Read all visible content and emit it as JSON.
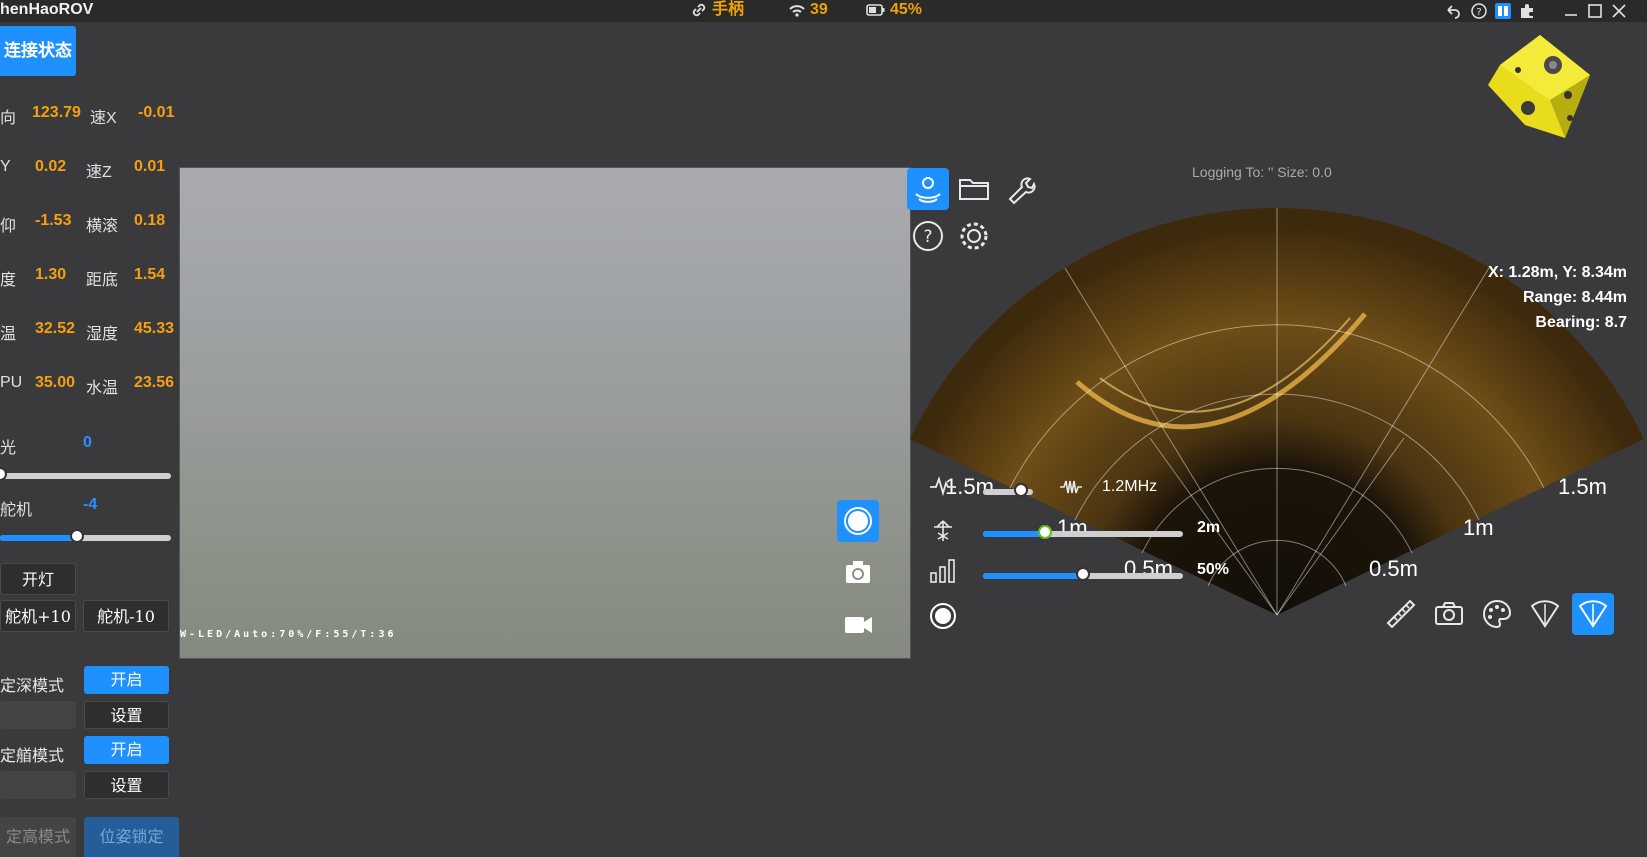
{
  "titlebar": {
    "app_title": "henHaoROV",
    "joystick_label": "手柄",
    "signal_value": "39",
    "battery_value": "45%"
  },
  "left_panel": {
    "connection_button": "连接状态",
    "telemetry": [
      {
        "label": "向",
        "value": "123.79"
      },
      {
        "label": "速X",
        "value": "-0.01"
      },
      {
        "label": "Y",
        "value": "0.02"
      },
      {
        "label": "速Z",
        "value": "0.01"
      },
      {
        "label": "仰",
        "value": "-1.53"
      },
      {
        "label": "横滚",
        "value": "0.18"
      },
      {
        "label": "度",
        "value": "1.30"
      },
      {
        "label": "距底",
        "value": "1.54"
      },
      {
        "label": "温",
        "value": "32.52"
      },
      {
        "label": "湿度",
        "value": "45.33"
      },
      {
        "label": "PU",
        "value": "35.00"
      },
      {
        "label": "水温",
        "value": "23.56"
      }
    ],
    "light": {
      "label": "光",
      "value": "0",
      "fraction": 0.0
    },
    "servo": {
      "label": "舵机",
      "value": "-4",
      "fraction": 0.45
    },
    "buttons": {
      "light_on": "开灯",
      "servo_plus": "舵机+10",
      "servo_minus": "舵机-10",
      "depth_mode_label": "定深模式",
      "depth_mode_on": "开启",
      "depth_set": "设置",
      "heading_mode_label": "定艏模式",
      "heading_mode_on": "开启",
      "heading_set": "设置",
      "altitude_mode": "定高模式",
      "attitude_lock": "位姿锁定"
    }
  },
  "video": {
    "osd_text": "W-LED/Auto:70%/F:55/T:36"
  },
  "sonar": {
    "logging_text": "Logging To: '' Size: 0.0",
    "cursor": {
      "xy": "X: 1.28m, Y: 8.34m",
      "range": "Range: 8.44m",
      "bearing": "Bearing: 8.7"
    },
    "range_labels": {
      "left_outer": "1.5m",
      "left_mid": "1m",
      "left_inner": "0.5m",
      "right_outer": "1.5m",
      "right_mid": "1m",
      "right_inner": "0.5m"
    },
    "frequency": {
      "label": "1.2MHz",
      "fraction": 0.75
    },
    "range_slider": {
      "label": "2m",
      "fraction": 0.31
    },
    "gain_slider": {
      "label": "50%",
      "fraction": 0.5
    }
  },
  "colors": {
    "accent": "#1e90ff",
    "value": "#f4a010"
  }
}
